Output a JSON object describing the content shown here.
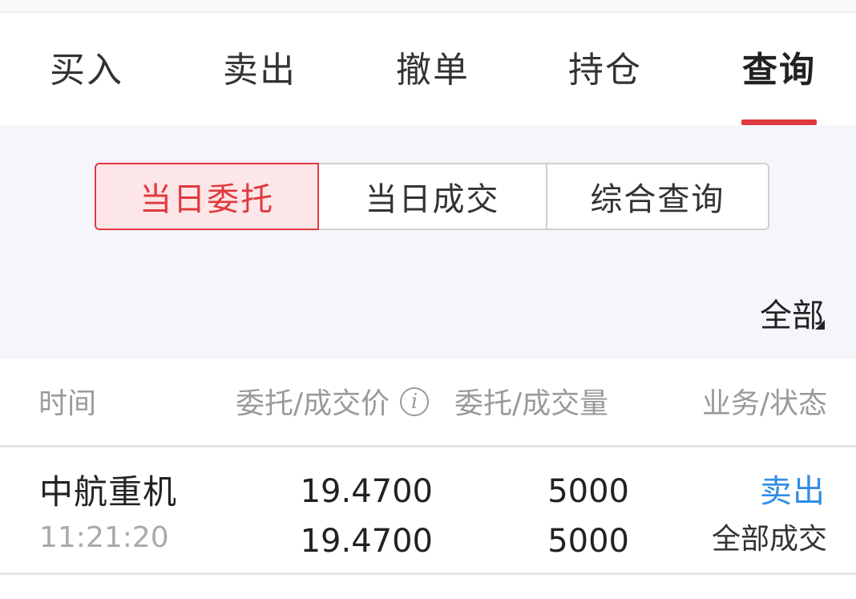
{
  "tabs": [
    {
      "label": "买入"
    },
    {
      "label": "卖出"
    },
    {
      "label": "撤单"
    },
    {
      "label": "持仓"
    },
    {
      "label": "查询",
      "active": true
    }
  ],
  "query_tabs": [
    {
      "label": "当日委托",
      "active": true
    },
    {
      "label": "当日成交"
    },
    {
      "label": "综合查询"
    }
  ],
  "filter": {
    "label": "全部"
  },
  "columns": {
    "time": "时间",
    "price": "委托/成交价",
    "qty": "委托/成交量",
    "status": "业务/状态"
  },
  "orders": [
    {
      "name": "中航重机",
      "time": "11:21:20",
      "order_price": "19.4700",
      "deal_price": "19.4700",
      "order_qty": "5000",
      "deal_qty": "5000",
      "side": "卖出",
      "status": "全部成交"
    }
  ],
  "colors": {
    "accent": "#e0393e",
    "sell_blue": "#2f8de4",
    "filter_bg": "#f5f6fc"
  },
  "icons": [
    "info-icon",
    "dropdown-corner-icon"
  ]
}
